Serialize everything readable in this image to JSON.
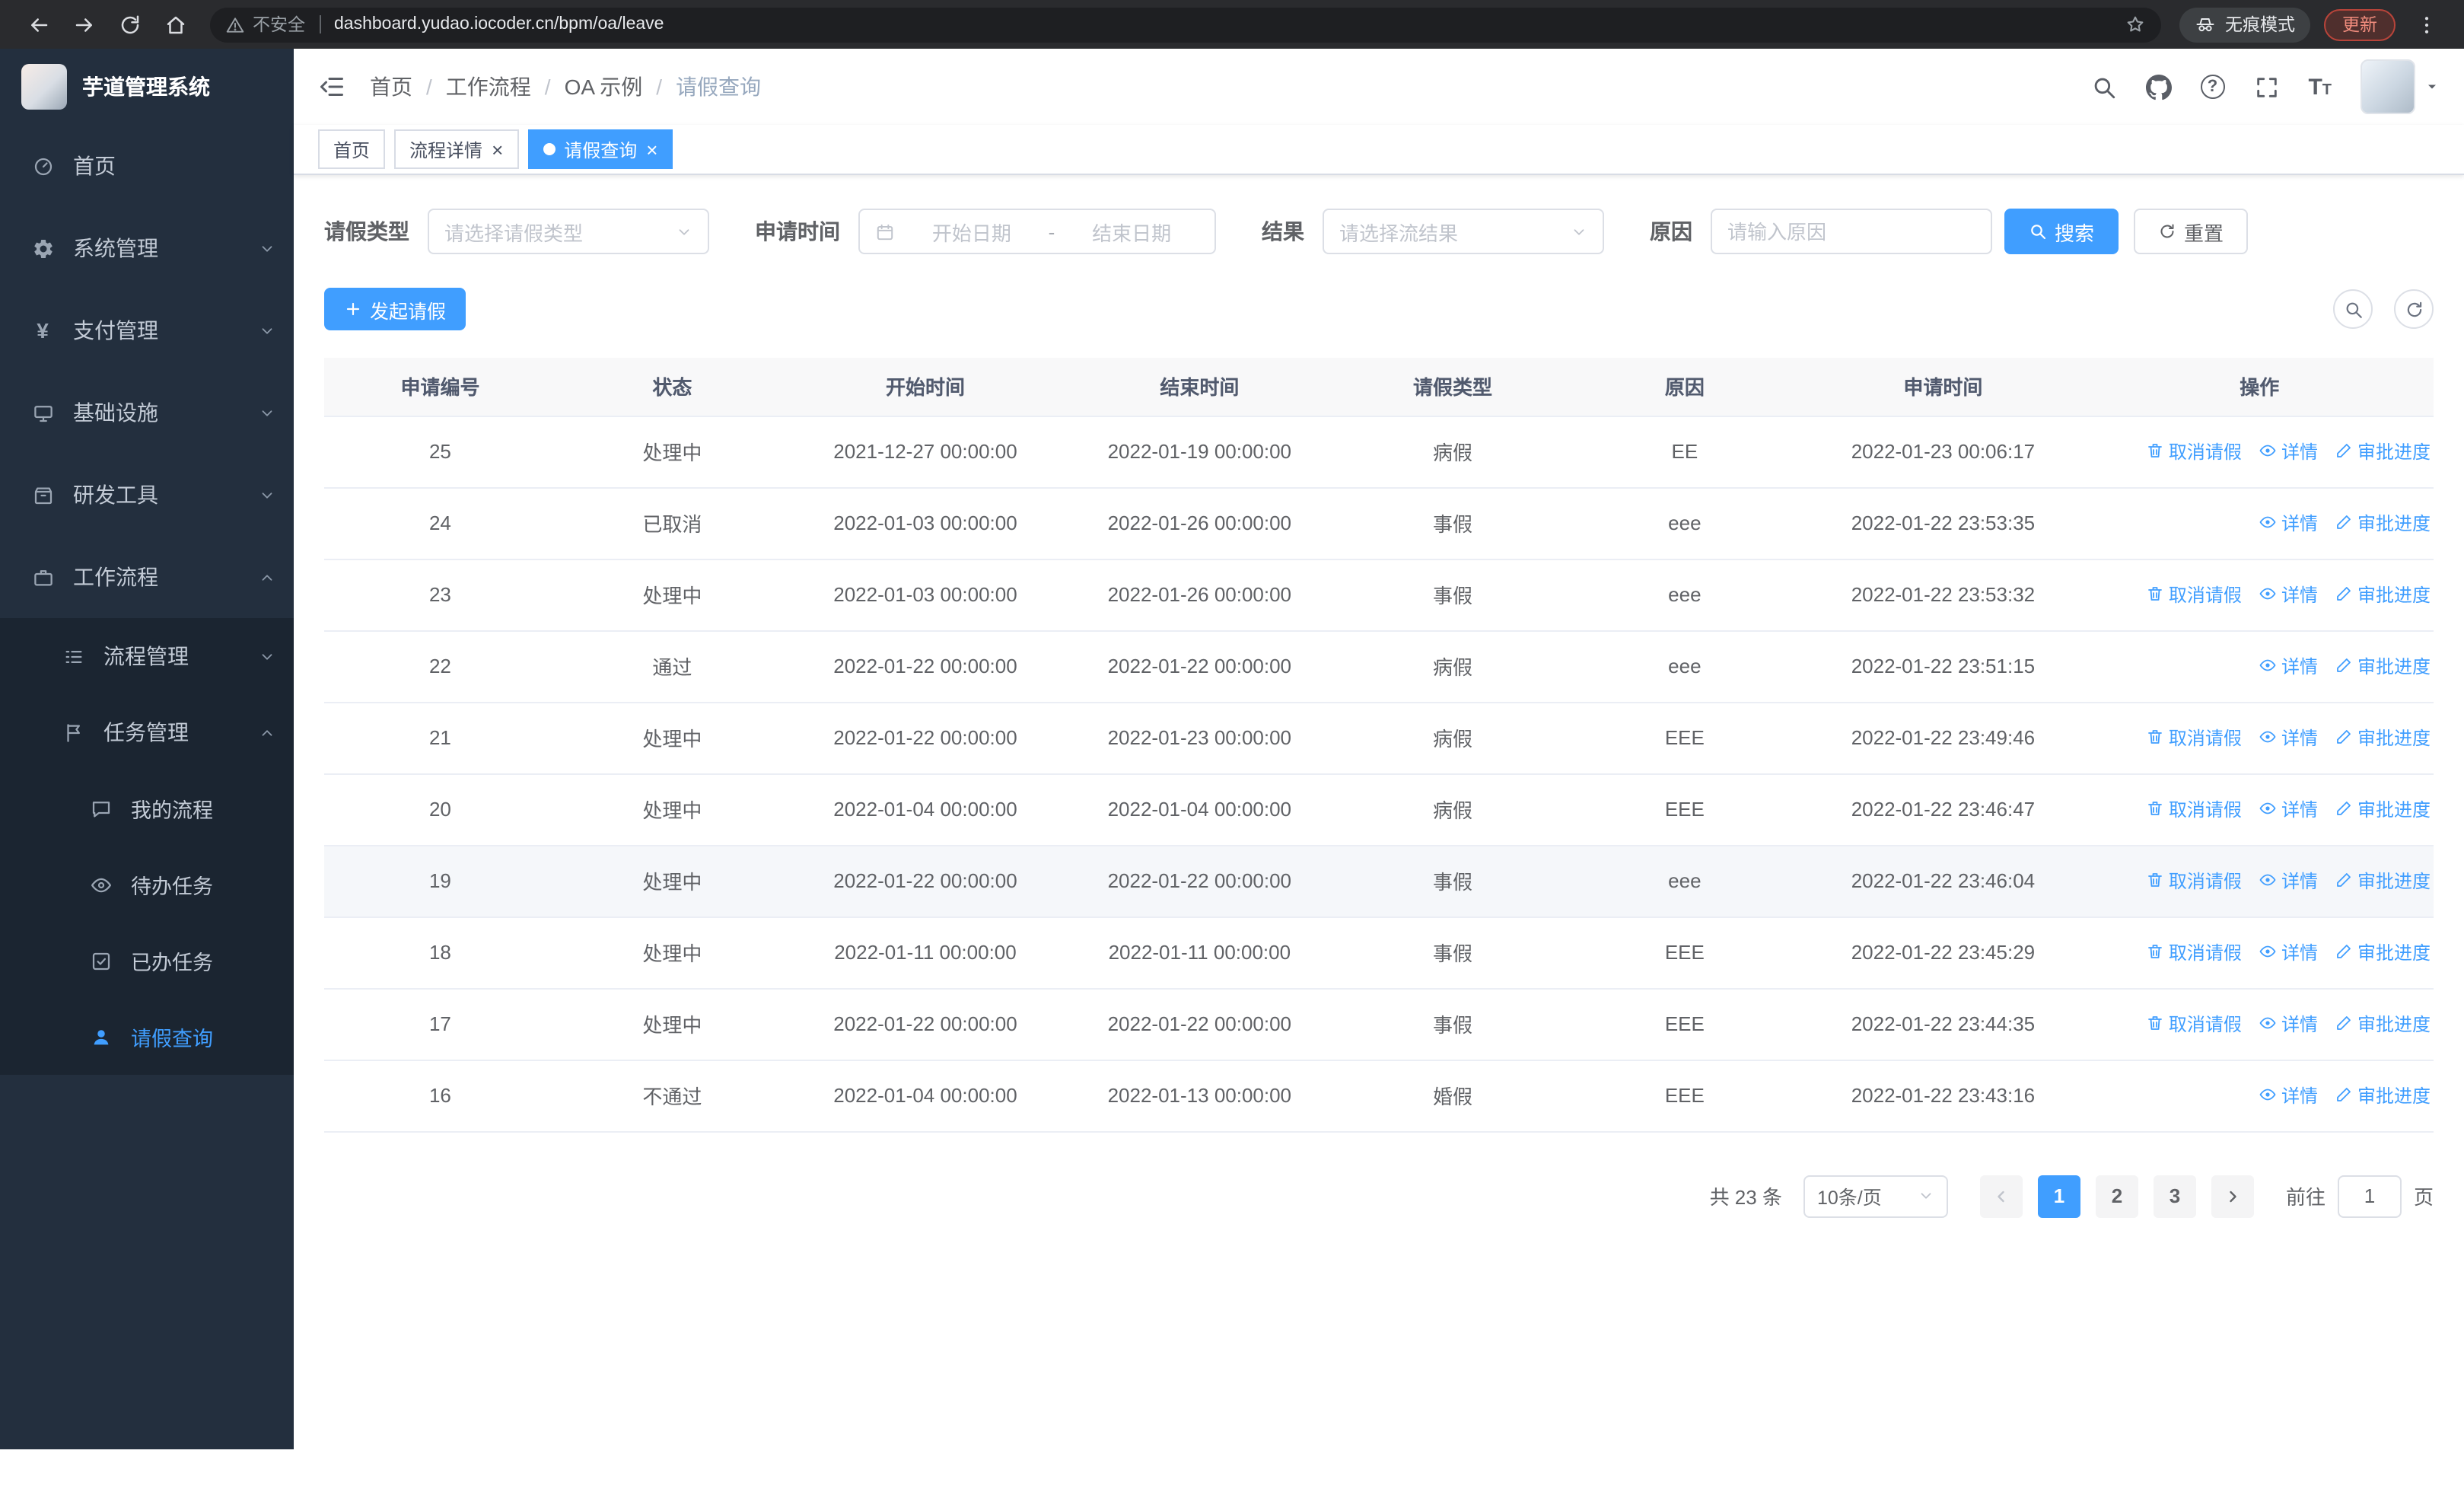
{
  "colors": {
    "accent": "#409eff"
  },
  "browser": {
    "security_label": "不安全",
    "url": "dashboard.yudao.iocoder.cn/bpm/oa/leave",
    "incognito_label": "无痕模式",
    "update_label": "更新"
  },
  "sidebar": {
    "app_title": "芋道管理系统",
    "items": [
      {
        "label": "首页"
      },
      {
        "label": "系统管理"
      },
      {
        "label": "支付管理"
      },
      {
        "label": "基础设施"
      },
      {
        "label": "研发工具"
      },
      {
        "label": "工作流程"
      }
    ],
    "workflow_children": [
      {
        "label": "流程管理"
      },
      {
        "label": "任务管理"
      }
    ],
    "task_children": [
      {
        "label": "我的流程"
      },
      {
        "label": "待办任务"
      },
      {
        "label": "已办任务"
      },
      {
        "label": "请假查询"
      }
    ]
  },
  "breadcrumb": {
    "separator": "/",
    "items": [
      "首页",
      "工作流程",
      "OA 示例",
      "请假查询"
    ]
  },
  "tabs": [
    {
      "label": "首页"
    },
    {
      "label": "流程详情"
    },
    {
      "label": "请假查询"
    }
  ],
  "filters": {
    "leave_type": {
      "label": "请假类型",
      "placeholder": "请选择请假类型"
    },
    "apply_time": {
      "label": "申请时间",
      "start_placeholder": "开始日期",
      "separator": "-",
      "end_placeholder": "结束日期"
    },
    "result": {
      "label": "结果",
      "placeholder": "请选择流结果"
    },
    "reason": {
      "label": "原因",
      "placeholder": "请输入原因"
    },
    "search_label": "搜索",
    "reset_label": "重置"
  },
  "toolbar": {
    "create_label": "发起请假"
  },
  "table": {
    "columns": [
      "申请编号",
      "状态",
      "开始时间",
      "结束时间",
      "请假类型",
      "原因",
      "申请时间",
      "操作"
    ],
    "action_labels": {
      "cancel": "取消请假",
      "detail": "详情",
      "progress": "审批进度"
    },
    "rows": [
      {
        "id": "25",
        "status": "处理中",
        "start": "2021-12-27 00:00:00",
        "end": "2022-01-19 00:00:00",
        "type": "病假",
        "reason": "EE",
        "apply_time": "2022-01-23 00:06:17",
        "actions": [
          "cancel",
          "detail",
          "progress"
        ],
        "highlight": false
      },
      {
        "id": "24",
        "status": "已取消",
        "start": "2022-01-03 00:00:00",
        "end": "2022-01-26 00:00:00",
        "type": "事假",
        "reason": "eee",
        "apply_time": "2022-01-22 23:53:35",
        "actions": [
          "detail",
          "progress"
        ],
        "highlight": false
      },
      {
        "id": "23",
        "status": "处理中",
        "start": "2022-01-03 00:00:00",
        "end": "2022-01-26 00:00:00",
        "type": "事假",
        "reason": "eee",
        "apply_time": "2022-01-22 23:53:32",
        "actions": [
          "cancel",
          "detail",
          "progress"
        ],
        "highlight": false
      },
      {
        "id": "22",
        "status": "通过",
        "start": "2022-01-22 00:00:00",
        "end": "2022-01-22 00:00:00",
        "type": "病假",
        "reason": "eee",
        "apply_time": "2022-01-22 23:51:15",
        "actions": [
          "detail",
          "progress"
        ],
        "highlight": false
      },
      {
        "id": "21",
        "status": "处理中",
        "start": "2022-01-22 00:00:00",
        "end": "2022-01-23 00:00:00",
        "type": "病假",
        "reason": "EEE",
        "apply_time": "2022-01-22 23:49:46",
        "actions": [
          "cancel",
          "detail",
          "progress"
        ],
        "highlight": false
      },
      {
        "id": "20",
        "status": "处理中",
        "start": "2022-01-04 00:00:00",
        "end": "2022-01-04 00:00:00",
        "type": "病假",
        "reason": "EEE",
        "apply_time": "2022-01-22 23:46:47",
        "actions": [
          "cancel",
          "detail",
          "progress"
        ],
        "highlight": false
      },
      {
        "id": "19",
        "status": "处理中",
        "start": "2022-01-22 00:00:00",
        "end": "2022-01-22 00:00:00",
        "type": "事假",
        "reason": "eee",
        "apply_time": "2022-01-22 23:46:04",
        "actions": [
          "cancel",
          "detail",
          "progress"
        ],
        "highlight": true
      },
      {
        "id": "18",
        "status": "处理中",
        "start": "2022-01-11 00:00:00",
        "end": "2022-01-11 00:00:00",
        "type": "事假",
        "reason": "EEE",
        "apply_time": "2022-01-22 23:45:29",
        "actions": [
          "cancel",
          "detail",
          "progress"
        ],
        "highlight": false
      },
      {
        "id": "17",
        "status": "处理中",
        "start": "2022-01-22 00:00:00",
        "end": "2022-01-22 00:00:00",
        "type": "事假",
        "reason": "EEE",
        "apply_time": "2022-01-22 23:44:35",
        "actions": [
          "cancel",
          "detail",
          "progress"
        ],
        "highlight": false
      },
      {
        "id": "16",
        "status": "不通过",
        "start": "2022-01-04 00:00:00",
        "end": "2022-01-13 00:00:00",
        "type": "婚假",
        "reason": "EEE",
        "apply_time": "2022-01-22 23:43:16",
        "actions": [
          "detail",
          "progress"
        ],
        "highlight": false
      }
    ]
  },
  "pagination": {
    "total": "共 23 条",
    "page_size": "10条/页",
    "pages": [
      "1",
      "2",
      "3"
    ],
    "active_page": "1",
    "goto_label": "前往",
    "goto_value": "1",
    "goto_suffix": "页"
  }
}
